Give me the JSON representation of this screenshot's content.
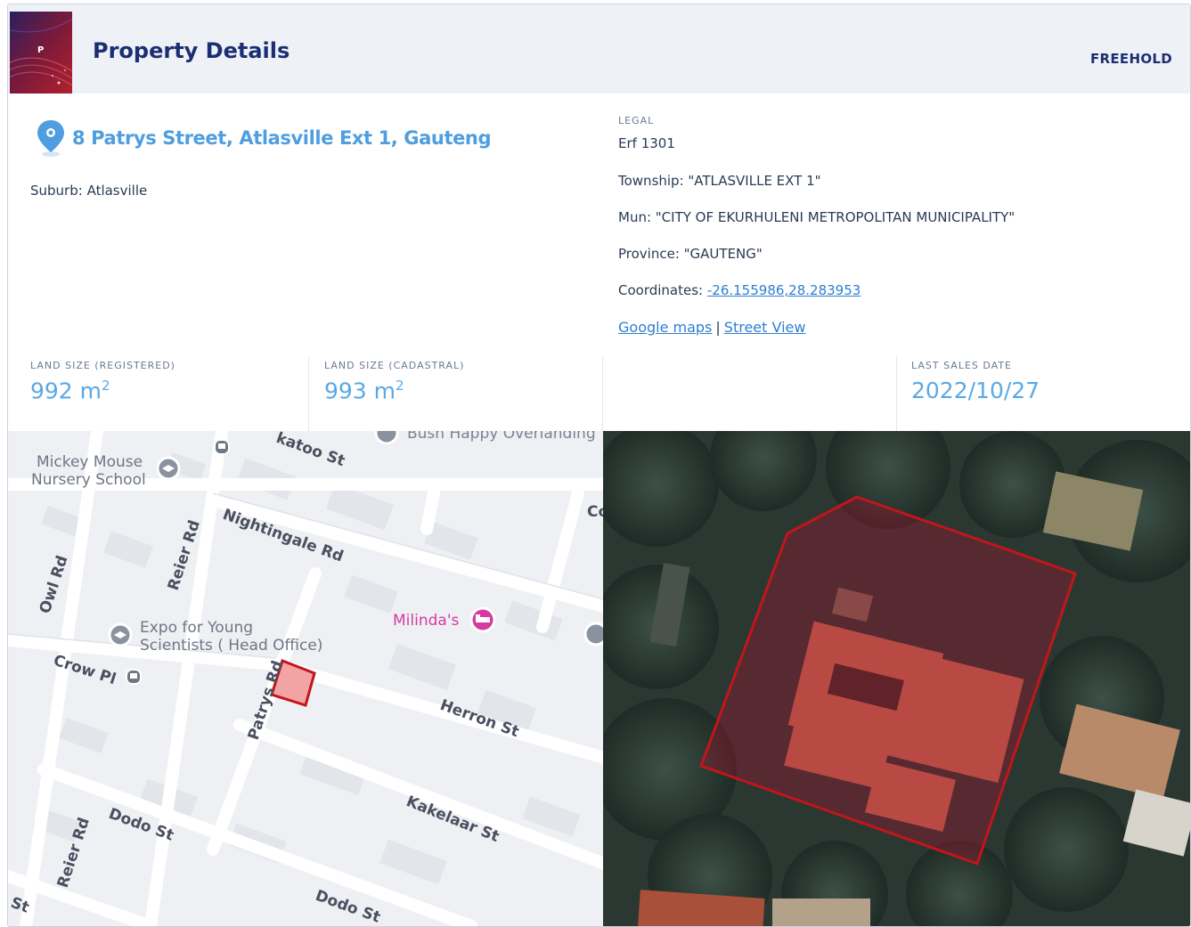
{
  "header": {
    "logo_letter": "P",
    "title": "Property Details",
    "tenure": "FREEHOLD"
  },
  "property": {
    "address": "8 Patrys Street, Atlasville Ext 1, Gauteng",
    "suburb": "Suburb: Atlasville"
  },
  "legal": {
    "label": "LEGAL",
    "erf": "Erf 1301",
    "township": "Township: \"ATLASVILLE EXT 1\"",
    "municipality": "Mun: \"CITY OF EKURHULENI METROPOLITAN MUNICIPALITY\"",
    "province": "Province: \"GAUTENG\"",
    "coordinates_label": "Coordinates: ",
    "coordinates_value": "-26.155986,28.283953",
    "google_maps": "Google maps",
    "separator": "|",
    "street_view": "Street View"
  },
  "stats": [
    {
      "label": "LAND SIZE (REGISTERED)",
      "value": "992 m",
      "unit_sup": "2"
    },
    {
      "label": "LAND SIZE (CADASTRAL)",
      "value": "993 m",
      "unit_sup": "2"
    },
    {
      "label": "LAST SALES DATE",
      "value": "2022/10/27"
    }
  ],
  "map": {
    "streets": {
      "katoo": "katoo St",
      "bush": "Bush Happy Overlanding",
      "nightingale": "Nightingale Rd",
      "reier_top": "Reier Rd",
      "owl": "Owl Rd",
      "crow": "Crow Pl",
      "patrys": "Patrys Rd",
      "herron": "Herron St",
      "kakelaar": "Kakelaar St",
      "dodo_left": "Dodo St",
      "dodo_bottom": "Dodo St",
      "reier_bottom": "Reier Rd",
      "st_edge": "St",
      "co_edge": "Co"
    },
    "pois": {
      "mickey_line1": "Mickey Mouse",
      "mickey_line2": "Nursery School",
      "expo_line1": "Expo for Young",
      "expo_line2": "Scientists ( Head Office)",
      "milinda": "Milinda's"
    }
  },
  "colors": {
    "header_title": "#1c2e73",
    "address": "#4f9ee0",
    "stat_value": "#5aa9e6",
    "parcel_outline": "#c0161b",
    "milinda_poi": "#d63aa1"
  }
}
